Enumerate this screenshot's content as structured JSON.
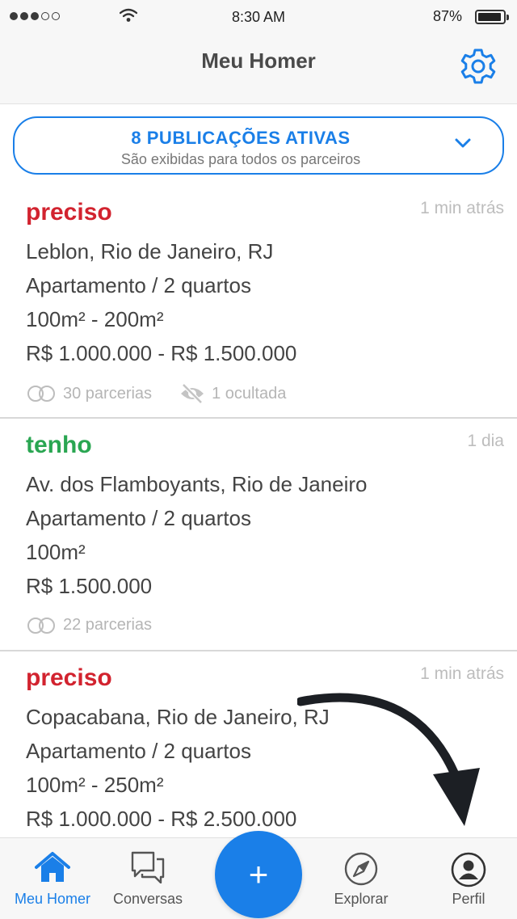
{
  "status_bar": {
    "time": "8:30 AM",
    "battery": "87%"
  },
  "nav": {
    "title": "Meu Homer",
    "settings_icon": "gear-icon"
  },
  "banner": {
    "title": "8 PUBLICAÇÕES ATIVAS",
    "subtitle": "São exibidas para todos os parceiros"
  },
  "posts": [
    {
      "type": "preciso",
      "time": "1 min atrás",
      "location": "Leblon, Rio de Janeiro, RJ",
      "property": "Apartamento / 2 quartos",
      "area": "100m² - 200m²",
      "price": "R$ 1.000.000 - R$ 1.500.000",
      "partners": "30 parcerias",
      "hidden": "1 ocultada"
    },
    {
      "type": "tenho",
      "time": "1 dia",
      "location": "Av. dos Flamboyants, Rio de Janeiro",
      "property": "Apartamento / 2 quartos",
      "area": "100m²",
      "price": "R$ 1.500.000",
      "partners": "22 parcerias"
    },
    {
      "type": "preciso",
      "time": "1 min atrás",
      "location": "Copacabana, Rio de Janeiro, RJ",
      "property": "Apartamento / 2 quartos",
      "area": "100m² - 250m²",
      "price": "R$ 1.000.000 - R$ 2.500.000"
    }
  ],
  "tabs": {
    "home": "Meu Homer",
    "chats": "Conversas",
    "add": "+",
    "explore": "Explorar",
    "profile": "Perfil"
  },
  "colors": {
    "accent": "#1a7fe8",
    "need": "#d2232f",
    "have": "#2aa652"
  }
}
